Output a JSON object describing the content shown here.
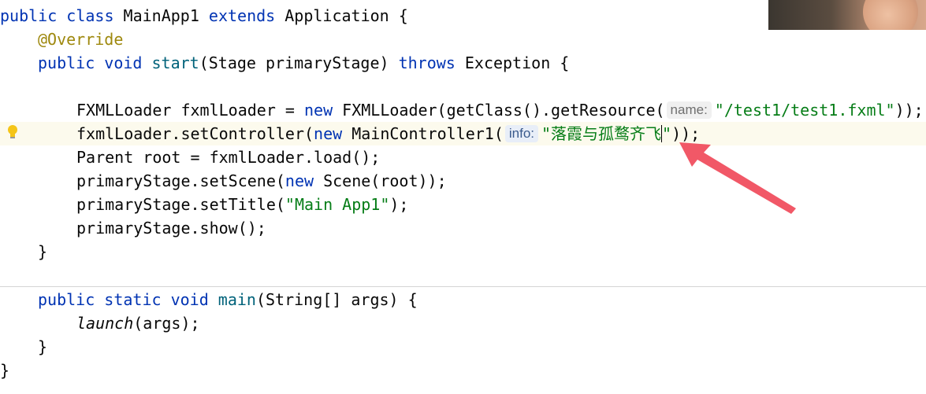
{
  "editor": {
    "lines": {
      "l1": {
        "a": "public class",
        "b": " MainApp1 ",
        "c": "extends",
        "d": " Application {"
      },
      "l2": {
        "a": "@Override"
      },
      "l3": {
        "a": "public void",
        "b": " start",
        "c": "(Stage primaryStage) ",
        "d": "throws",
        "e": " Exception {"
      },
      "l5": {
        "a": "FXMLLoader fxmlLoader = ",
        "b": "new",
        "c": " FXMLLoader(getClass().getResource(",
        "hint": "name:",
        "str": "\"/test1/test1.fxml\"",
        "end": "));"
      },
      "l6": {
        "a": "fxmlLoader.setController(",
        "b": "new",
        "c": " MainController1(",
        "hint": "info:",
        "str": "\"落霞与孤鹜齐飞",
        "str2": "\"",
        "end": "));"
      },
      "l7": {
        "a": "Parent root = fxmlLoader.load();"
      },
      "l8": {
        "a": "primaryStage.setScene(",
        "b": "new",
        "c": " Scene(root));"
      },
      "l9": {
        "a": "primaryStage.setTitle(",
        "str": "\"Main App1\"",
        "end": ");"
      },
      "l10": {
        "a": "primaryStage.show();"
      },
      "l11": {
        "a": "}"
      },
      "l13": {
        "a": "public static void",
        "b": " main",
        "c": "(String[] args) {"
      },
      "l14": {
        "a": "launch",
        "b": "(args);"
      },
      "l15": {
        "a": "}"
      },
      "l16": {
        "a": "}"
      }
    }
  },
  "colors": {
    "keyword": "#0033b3",
    "annotation": "#9e880d",
    "method": "#00627a",
    "string": "#067d17",
    "arrow": "#f04a5a"
  },
  "icons": {
    "gutter": "lightbulb-icon",
    "overlay": "red-arrow-annotation"
  }
}
